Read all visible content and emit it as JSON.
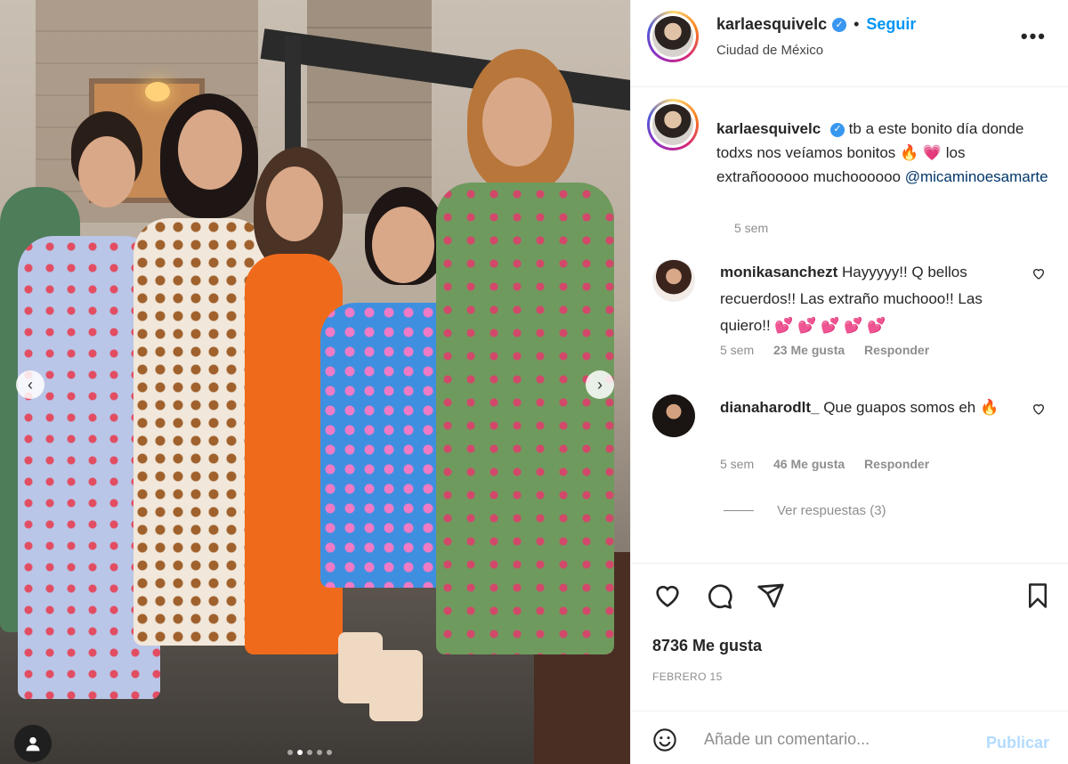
{
  "photo": {
    "nav_prev_glyph": "‹",
    "nav_next_glyph": "›",
    "dot_count": 5,
    "active_dot": 1
  },
  "header": {
    "username": "karlaesquivelc",
    "verified_glyph": "✓",
    "separator": "•",
    "follow_label": "Seguir",
    "location": "Ciudad de México",
    "more_glyph": "•••"
  },
  "caption": {
    "username": "karlaesquivelc",
    "text": "tb a este bonito día donde todxs nos veíamos bonitos 🔥 💗 los extrañoooooo muchoooooo",
    "mention": "@micaminoesamarte",
    "time": "5 sem"
  },
  "comments": [
    {
      "username": "monikasanchezt",
      "text": "Hayyyyy!! Q bellos recuerdos!! Las extraño muchooo!! Las quiero!! 💕 💕 💕 💕 💕",
      "time": "5 sem",
      "likes": "23 Me gusta",
      "reply": "Responder"
    },
    {
      "username": "dianaharodlt_",
      "text": "Que guapos somos eh 🔥",
      "time": "5 sem",
      "likes": "46 Me gusta",
      "reply": "Responder"
    }
  ],
  "view_replies": "Ver respuestas (3)",
  "actions": {
    "likes": "8736 Me gusta",
    "date": "FEBRERO 15"
  },
  "add_comment": {
    "placeholder": "Añade un comentario...",
    "publish_label": "Publicar"
  },
  "colors": {
    "accent": "#0095f6",
    "verified": "#3897f0",
    "muted": "#8e8e8e"
  }
}
